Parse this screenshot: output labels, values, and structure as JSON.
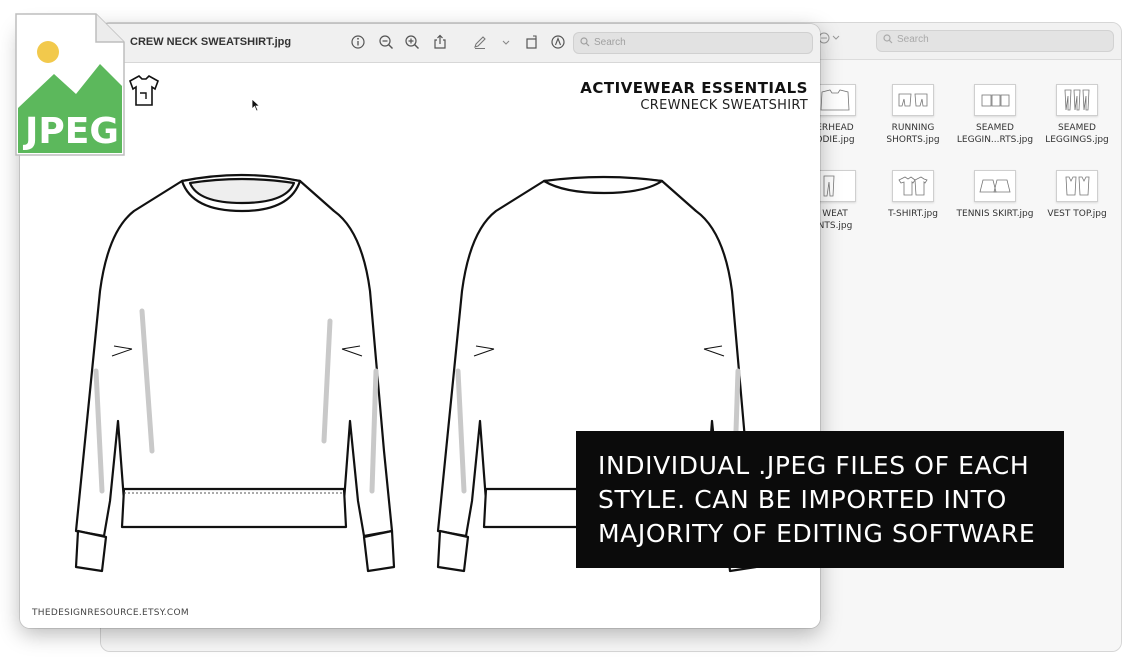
{
  "finder": {
    "search_placeholder": "Search",
    "files": [
      {
        "name": "ERHEAD\nODIE.jpg"
      },
      {
        "name": "RUNNING\nSHORTS.jpg"
      },
      {
        "name": "SEAMED\nLEGGIN...RTS.jpg"
      },
      {
        "name": "SEAMED\nLEGGINGS.jpg"
      },
      {
        "name": "WEAT\nNTS.jpg"
      },
      {
        "name": "T-SHIRT.jpg"
      },
      {
        "name": "TENNIS SKIRT.jpg"
      },
      {
        "name": "VEST TOP.jpg"
      }
    ]
  },
  "preview": {
    "filename": "CREW NECK SWEATSHIRT.jpg",
    "search_placeholder": "Search",
    "toolbar_icons": [
      "info-icon",
      "zoom-out-icon",
      "zoom-in-icon",
      "share-icon",
      "markup-icon",
      "chevron-down-icon",
      "rotate-icon",
      "annotate-icon"
    ]
  },
  "document": {
    "brand_title": "ACTIVEWEAR ESSENTIALS",
    "brand_subtitle": "CREWNECK SWEATSHIRT",
    "footer_credit": "THEDESIGNRESOURCE.ETSY.COM"
  },
  "jpeg_badge": {
    "label": "JPEG",
    "colors": {
      "green": "#5cb85c",
      "sun": "#f2c94c"
    }
  },
  "caption": {
    "lines": [
      "INDIVIDUAL .JPEG FILES OF EACH",
      "STYLE. CAN BE IMPORTED INTO",
      "MAJORITY OF EDITING SOFTWARE"
    ]
  }
}
